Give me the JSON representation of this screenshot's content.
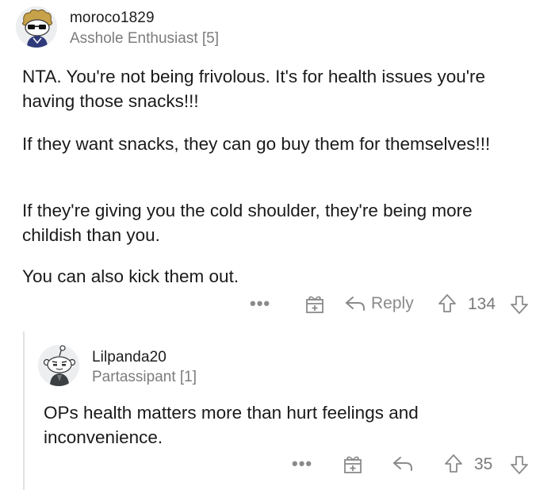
{
  "top_comment": {
    "username": "moroco1829",
    "flair": "Asshole Enthusiast [5]",
    "paragraphs": [
      "NTA. You're not being frivolous. It's for health issues you're having those snacks!!!",
      "If they want snacks, they can go buy them for themselves!!!",
      "If they're giving you the cold shoulder, they're being more childish than you.",
      "You can also kick them out."
    ],
    "actions": {
      "more": "•••",
      "reply_label": "Reply",
      "vote_count": "134"
    }
  },
  "reply_comment": {
    "username": "Lilpanda20",
    "flair": "Partassipant [1]",
    "paragraphs": [
      "OPs health matters more than hurt feelings and inconvenience."
    ],
    "actions": {
      "more": "•••",
      "vote_count": "35"
    }
  },
  "icons": {
    "more": "more-options-icon",
    "award": "award-gift-icon",
    "reply": "reply-arrow-icon",
    "upvote": "upvote-arrow-icon",
    "downvote": "downvote-arrow-icon"
  },
  "colors": {
    "text": "#1a1a1b",
    "muted": "#8a8a8a",
    "thread_line": "#e3e3e3"
  }
}
